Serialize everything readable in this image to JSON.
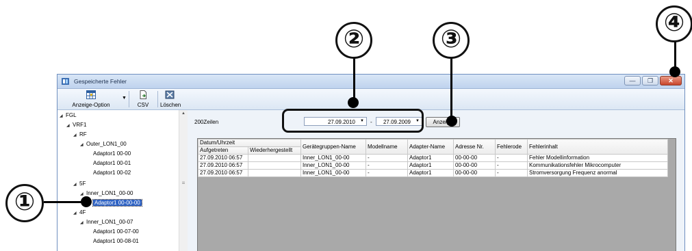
{
  "window": {
    "title": "Gespeicherte Fehler",
    "buttons": {
      "minimize": "—",
      "restore": "❐",
      "close": "✕"
    }
  },
  "toolbar": {
    "display_option": "Anzeige-Option",
    "csv": "CSV",
    "delete": "Löschen"
  },
  "tree": {
    "items": [
      {
        "label": "FGL",
        "arrow": "◢"
      },
      {
        "label": "VRF1",
        "arrow": "◢"
      },
      {
        "label": "RF",
        "arrow": "◢"
      },
      {
        "label": "Outer_LON1_00",
        "arrow": "◢"
      },
      {
        "label": "Adaptor1 00-00",
        "arrow": ""
      },
      {
        "label": "Adaptor1 00-01",
        "arrow": ""
      },
      {
        "label": "Adaptor1 00-02",
        "arrow": ""
      },
      {
        "label": "5F",
        "arrow": "◢"
      },
      {
        "label": "Inner_LON1_00-00",
        "arrow": "◢"
      },
      {
        "label": "Adaptor1 00-00-00",
        "arrow": "",
        "selected": true
      },
      {
        "label": "4F",
        "arrow": "◢"
      },
      {
        "label": "Inner_LON1_00-07",
        "arrow": "◢"
      },
      {
        "label": "Adaptor1 00-07-00",
        "arrow": ""
      },
      {
        "label": "Adaptor1 00-08-01",
        "arrow": ""
      }
    ]
  },
  "filter": {
    "rows_label": "200Zeilen",
    "date_from": "27.09.2010",
    "date_separator": "-",
    "date_to": "27.09.2009",
    "show_button": "Anzeige"
  },
  "table": {
    "group_header": "Datum/Uhrzeit",
    "headers": [
      "Aufgetreten",
      "Wiederhergestellt",
      "Gerätegruppen-Name",
      "Modellname",
      "Adapter-Name",
      "Adresse Nr.",
      "Fehlerode",
      "Fehlerinhalt"
    ],
    "rows": [
      [
        "27.09.2010 06:57",
        "",
        "Inner_LON1_00-00",
        "-",
        "Adaptor1",
        "00-00-00",
        "-",
        "Fehler Modellinformation"
      ],
      [
        "27.09.2010 06:57",
        "",
        "Inner_LON1_00-00",
        "-",
        "Adaptor1",
        "00-00-00",
        "-",
        "Kommunikationsfehler Mikrocomputer"
      ],
      [
        "27.09.2010 06:57",
        "",
        "Inner_LON1_00-00",
        "-",
        "Adaptor1",
        "00-00-00",
        "-",
        "Stromversorgung Frequenz anormal"
      ]
    ]
  },
  "callouts": [
    "①",
    "②",
    "③",
    "④"
  ],
  "colors": {
    "selection": "#2f63c4",
    "window_frame": "#dde7f3"
  }
}
